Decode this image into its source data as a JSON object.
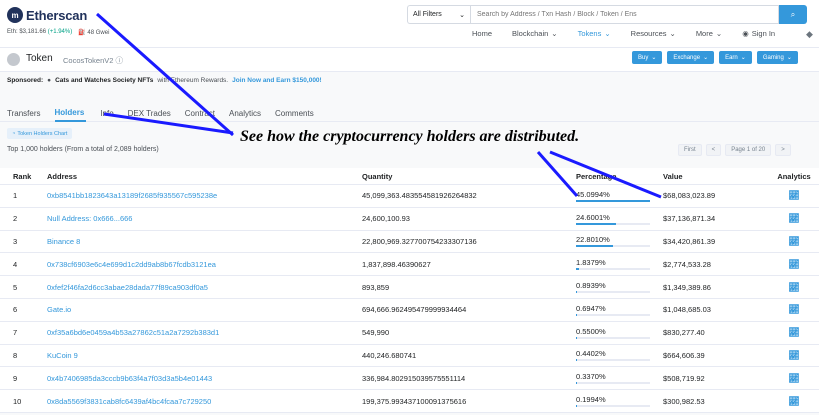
{
  "header": {
    "logo_text": "Etherscan",
    "eth_price": "Eth: $3,181.66",
    "eth_change": "(+1.94%)",
    "gas": "48 Gwei"
  },
  "search": {
    "filter_label": "All Filters",
    "placeholder": "Search by Address / Txn Hash / Block / Token / Ens",
    "button_icon": "search-icon"
  },
  "nav": {
    "items": [
      "Home",
      "Blockchain",
      "Tokens",
      "Resources",
      "More",
      "Sign In"
    ],
    "eth_icon": "ethereum-icon"
  },
  "token": {
    "label": "Token",
    "name": "CocosTokenV2",
    "actions": [
      "Buy",
      "Exchange",
      "Earn",
      "Gaming"
    ]
  },
  "sponsored": {
    "prefix": "Sponsored:",
    "title": "Cats and Watches Society NFTs",
    "middle": "with Ethereum Rewards.",
    "link": "Join Now and Earn $150,000!"
  },
  "tabs": [
    "Transfers",
    "Holders",
    "Info",
    "DEX Trades",
    "Contract",
    "Analytics",
    "Comments"
  ],
  "active_tab": "Holders",
  "chart_button": "Token Holders Chart",
  "summary": "Top 1,000 holders (From a total of 2,089 holders)",
  "pager": {
    "first": "First",
    "prev": "<",
    "page": "Page 1 of 20",
    "next": ">"
  },
  "annotation": "See how the cryptocurrency holders are distributed.",
  "table": {
    "columns": [
      "Rank",
      "Address",
      "Quantity",
      "Percentage",
      "Value",
      "Analytics"
    ],
    "rows": [
      {
        "rank": "1",
        "address": "0xb8541bb1823643a13189f2685f935567c595238e",
        "quantity": "45,099,363.483554581926264832",
        "percentage": "45.0994%",
        "pct": 45.0994,
        "value": "$68,083,023.89"
      },
      {
        "rank": "2",
        "address": "Null Address: 0x666...666",
        "quantity": "24,600,100.93",
        "percentage": "24.6001%",
        "pct": 24.6001,
        "value": "$37,136,871.34"
      },
      {
        "rank": "3",
        "address": "Binance 8",
        "quantity": "22,800,969.327700754233307136",
        "percentage": "22.8010%",
        "pct": 22.801,
        "value": "$34,420,861.39"
      },
      {
        "rank": "4",
        "address": "0x738cf6903e6c4e699d1c2dd9ab8b67fcdb3121ea",
        "quantity": "1,837,898.46390627",
        "percentage": "1.8379%",
        "pct": 1.8379,
        "value": "$2,774,533.28"
      },
      {
        "rank": "5",
        "address": "0xfef2f46fa2d6cc3abae28dada77f89ca903df0a5",
        "quantity": "893,859",
        "percentage": "0.8939%",
        "pct": 0.8939,
        "value": "$1,349,389.86"
      },
      {
        "rank": "6",
        "address": "Gate.io",
        "quantity": "694,666.962495479999934464",
        "percentage": "0.6947%",
        "pct": 0.6947,
        "value": "$1,048,685.03"
      },
      {
        "rank": "7",
        "address": "0xf35a6bd6e0459a4b53a27862c51a2a7292b383d1",
        "quantity": "549,990",
        "percentage": "0.5500%",
        "pct": 0.55,
        "value": "$830,277.40"
      },
      {
        "rank": "8",
        "address": "KuCoin 9",
        "quantity": "440,246.680741",
        "percentage": "0.4402%",
        "pct": 0.4402,
        "value": "$664,606.39"
      },
      {
        "rank": "9",
        "address": "0x4b7406985da3cccb9b63f4a7f03d3a5b4e01443",
        "quantity": "336,984.802915039575551114",
        "percentage": "0.3370%",
        "pct": 0.337,
        "value": "$508,719.92"
      },
      {
        "rank": "10",
        "address": "0x8da5569f3831cab8fc6439af4bc4fcaa7c729250",
        "quantity": "199,375.993437100091375616",
        "percentage": "0.1994%",
        "pct": 0.1994,
        "value": "$300,982.53"
      }
    ]
  },
  "colors": {
    "accent": "#3498db",
    "annotation_arrow": "#1a1aff"
  }
}
